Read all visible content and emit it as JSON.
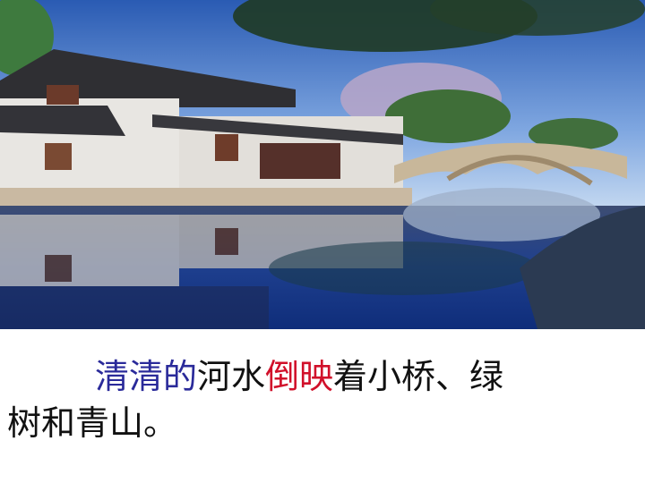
{
  "slide": {
    "background_color": "#ffffff",
    "photo": {
      "subject_icon": "canal-town-photo"
    },
    "caption": {
      "line1": [
        {
          "text": "清清的",
          "color": "#2a2a9a"
        },
        {
          "text": "河水",
          "color": "#111111"
        },
        {
          "text": "倒映",
          "color": "#d1102a"
        },
        {
          "text": "着小桥、绿",
          "color": "#111111"
        }
      ],
      "line2": [
        {
          "text": "树和青山。",
          "color": "#111111"
        }
      ]
    }
  }
}
